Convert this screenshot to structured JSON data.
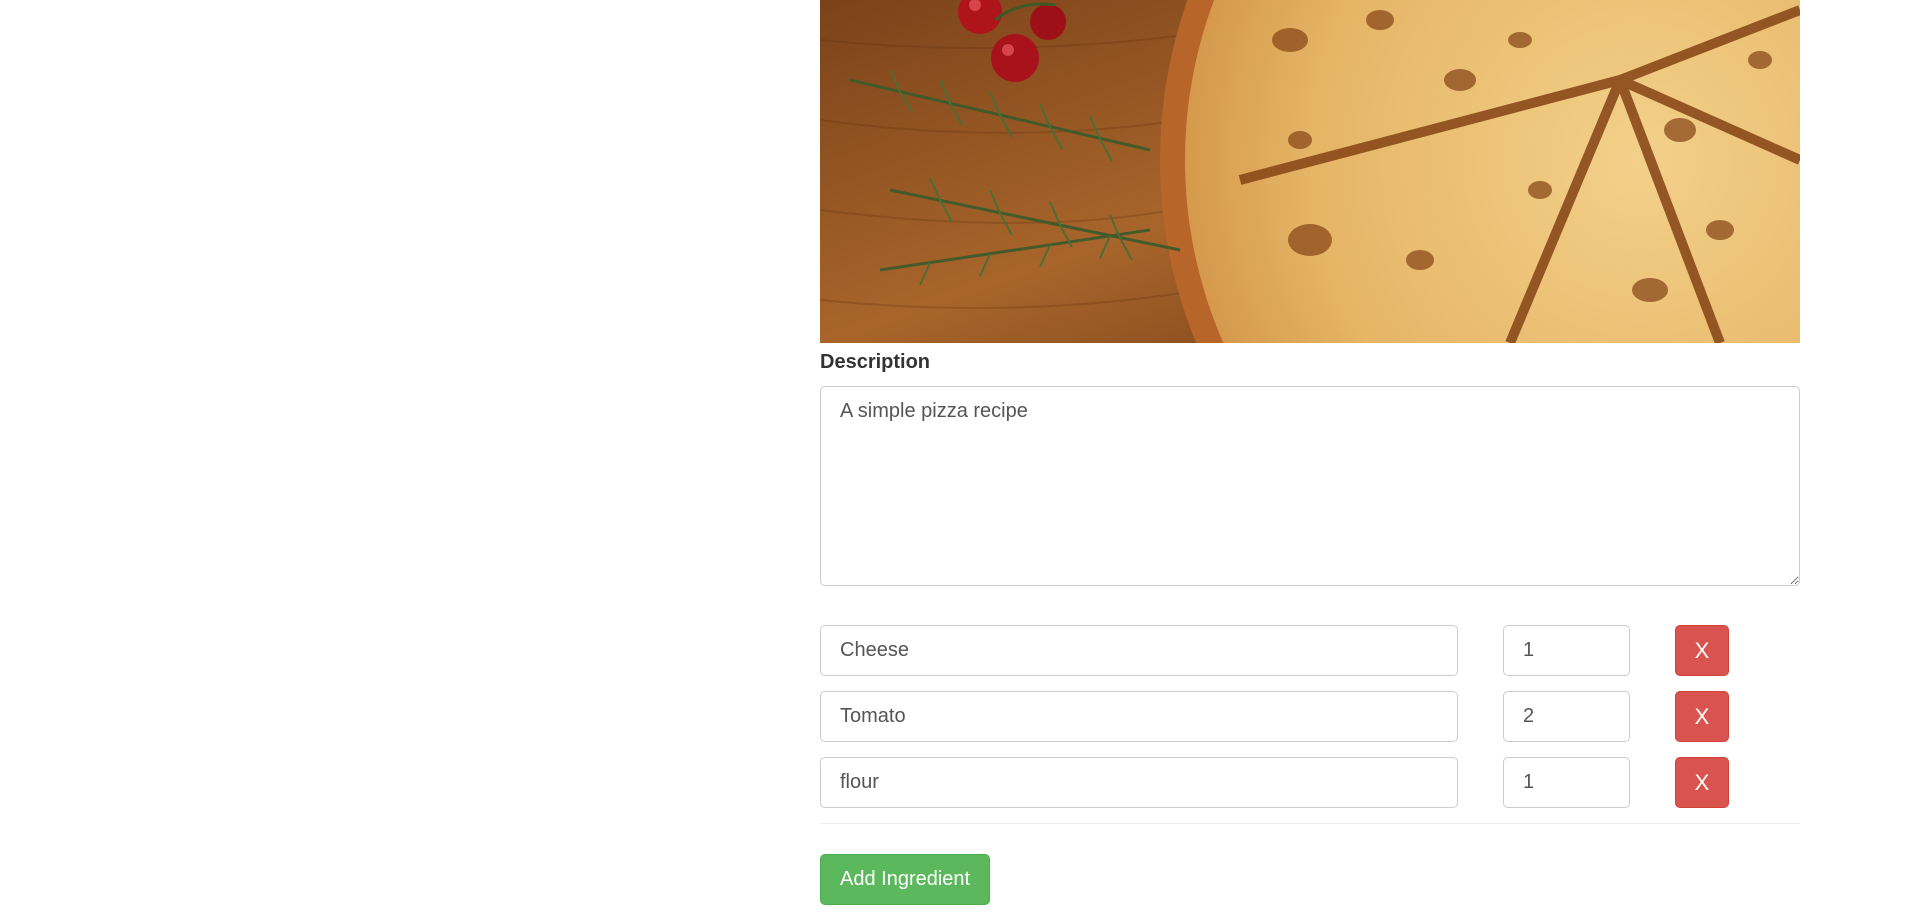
{
  "recipe_image": {
    "depicts": "pizza-with-rosemary-and-cherry-tomatoes"
  },
  "description": {
    "label": "Description",
    "value": "A simple pizza recipe"
  },
  "ingredients": [
    {
      "name": "Cheese",
      "quantity": "1",
      "remove_label": "X"
    },
    {
      "name": "Tomato",
      "quantity": "2",
      "remove_label": "X"
    },
    {
      "name": "flour",
      "quantity": "1",
      "remove_label": "X"
    }
  ],
  "add_ingredient_label": "Add Ingredient",
  "colors": {
    "danger": "#d9534f",
    "success": "#5cb85c",
    "border": "#cccccc"
  }
}
